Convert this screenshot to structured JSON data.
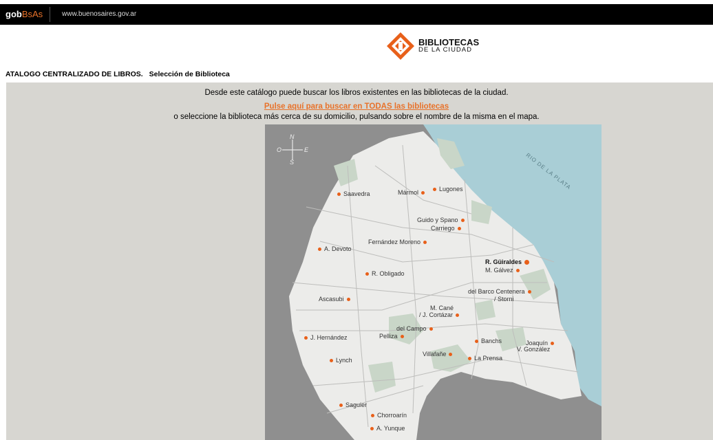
{
  "header": {
    "brand_gob": "gob",
    "brand_bsas": "BsAs",
    "site_url": "www.buenosaires.gov.ar"
  },
  "logo": {
    "title": "BIBLIOTECAS",
    "subtitle": "DE LA CIUDAD"
  },
  "breadcrumb": {
    "catalog": "ATALOGO CENTRALIZADO DE LIBROS.",
    "section": "Selección de Biblioteca"
  },
  "intro": {
    "line1": "Desde este catálogo puede buscar los libros existentes en las bibliotecas de la ciudad.",
    "link": "Pulse aquí para buscar en TODAS las bibliotecas",
    "line3": "o seleccione la biblioteca más cerca de su domicilio, pulsando sobre el nombre de la misma en el mapa."
  },
  "map": {
    "river_label": "RIO DE LA PLATA",
    "compass": {
      "n": "N",
      "s": "S",
      "e": "E",
      "o": "O"
    },
    "colors": {
      "land": "#ececea",
      "river": "#a9ced6",
      "outside": "#8f8f8f",
      "park": "#c9d6c8",
      "dot": "#e8601a"
    },
    "libraries": {
      "saavedra": "Saavedra",
      "marmol": "Mármol",
      "lugones": "Lugones",
      "guido": "Guido y Spano",
      "carriego": "Carriego",
      "fmoreno": "Fernández Moreno",
      "devoto": "A. Devoto",
      "guiraldes": "R. Güiraldes",
      "galvez": "M. Gálvez",
      "obligado": "R. Obligado",
      "barco1": "del Barco Centenera",
      "barco2": "/ Storni",
      "ascasubi": "Ascasubi",
      "cane1": "M. Cané",
      "cane2": "/ J. Cortázar",
      "delcampo": "del Campo",
      "pelliza": "Pelliza",
      "hernandez": "J. Hernández",
      "banchs": "Banchs",
      "joaquin1": "Joaquín",
      "joaquin2": "V. González",
      "villafane": "Villafañe",
      "laprensa": "La Prensa",
      "lynch": "Lynch",
      "saguier": "Saguier",
      "chorroarin": "Chorroarín",
      "yunque": "A. Yunque"
    }
  }
}
